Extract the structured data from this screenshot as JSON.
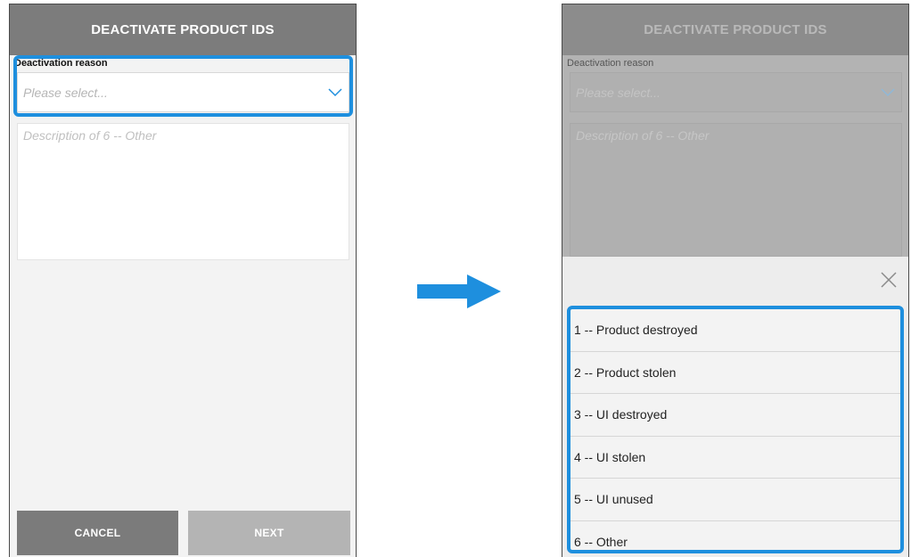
{
  "left_screen": {
    "header_title": "DEACTIVATE PRODUCT IDS",
    "field_label": "Deactivation reason",
    "select_placeholder": "Please select...",
    "description_placeholder": "Description of 6 -- Other",
    "cancel_label": "CANCEL",
    "next_label": "NEXT"
  },
  "right_screen": {
    "header_title": "DEACTIVATE PRODUCT IDS",
    "field_label": "Deactivation reason",
    "select_placeholder": "Please select...",
    "description_placeholder": "Description of 6 -- Other",
    "options": [
      "1 -- Product destroyed",
      "2 -- Product stolen",
      "3 -- UI destroyed",
      "4 -- UI stolen",
      "5 -- UI unused",
      "6 -- Other"
    ]
  },
  "icons": {
    "chevron": "chevron-down-icon",
    "close": "close-icon",
    "arrow": "arrow-right-icon"
  },
  "colors": {
    "header": "#7c7c7c",
    "highlight": "#1e8fde",
    "arrow": "#1e8fde",
    "cancel_button": "#7b7b7b",
    "next_button": "#b4b4b4"
  }
}
